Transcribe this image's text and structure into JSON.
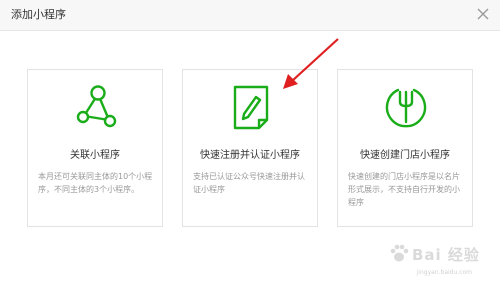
{
  "dialog": {
    "title": "添加小程序"
  },
  "cards": [
    {
      "icon": "link-network-icon",
      "title": "关联小程序",
      "description": "本月还可关联同主体的10个小程序，不同主体的3个小程序。"
    },
    {
      "icon": "edit-document-icon",
      "title": "快速注册并认证小程序",
      "description": "支持已认证公众号快速注册并认证小程序"
    },
    {
      "icon": "store-fork-icon",
      "title": "快速创建门店小程序",
      "description": "快速创建的门店小程序是以名片形式展示，不支持自行开发的小程序"
    }
  ],
  "watermark": {
    "logo": "Bai 经验",
    "url": "jingyan.baidu.com"
  },
  "colors": {
    "accent": "#1aad19",
    "annotation_arrow": "#e02020"
  }
}
